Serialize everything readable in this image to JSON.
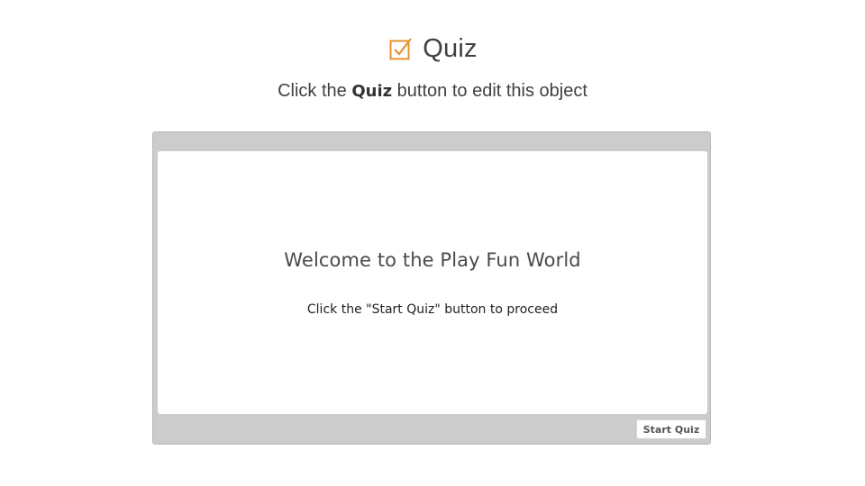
{
  "header": {
    "title": "Quiz",
    "icon": "checkbox-check-icon",
    "icon_color": "#e8912d"
  },
  "instruction": {
    "prefix": "Click the",
    "bold_word": "Quiz",
    "suffix": "button to edit this object"
  },
  "quiz": {
    "slide_title": "Welcome to the Play Fun World",
    "slide_text": "Click the \"Start Quiz\" button to proceed",
    "start_button_label": "Start Quiz"
  }
}
